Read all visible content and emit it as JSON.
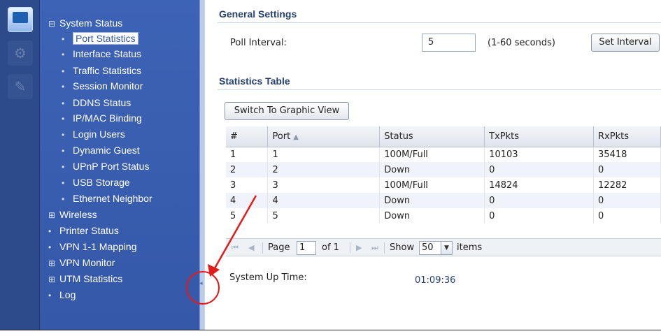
{
  "nav": {
    "items": [
      {
        "prefix": "⊟",
        "label": "System Status",
        "level": 0
      },
      {
        "prefix": "•",
        "label": "Port Statistics",
        "level": 1,
        "selected": true
      },
      {
        "prefix": "•",
        "label": "Interface Status",
        "level": 1
      },
      {
        "prefix": "•",
        "label": "Traffic Statistics",
        "level": 1
      },
      {
        "prefix": "•",
        "label": "Session Monitor",
        "level": 1
      },
      {
        "prefix": "•",
        "label": "DDNS Status",
        "level": 1
      },
      {
        "prefix": "•",
        "label": "IP/MAC Binding",
        "level": 1
      },
      {
        "prefix": "•",
        "label": "Login Users",
        "level": 1
      },
      {
        "prefix": "•",
        "label": "Dynamic Guest",
        "level": 1
      },
      {
        "prefix": "•",
        "label": "UPnP Port Status",
        "level": 1
      },
      {
        "prefix": "•",
        "label": "USB Storage",
        "level": 1
      },
      {
        "prefix": "•",
        "label": "Ethernet Neighbor",
        "level": 1
      },
      {
        "prefix": "⊞",
        "label": "Wireless",
        "level": 0
      },
      {
        "prefix": "•",
        "label": "Printer Status",
        "level": 0
      },
      {
        "prefix": "•",
        "label": "VPN 1-1 Mapping",
        "level": 0
      },
      {
        "prefix": "⊞",
        "label": "VPN Monitor",
        "level": 0
      },
      {
        "prefix": "⊞",
        "label": "UTM Statistics",
        "level": 0
      },
      {
        "prefix": "•",
        "label": "Log",
        "level": 0
      }
    ]
  },
  "general": {
    "title": "General Settings",
    "poll_label": "Poll Interval:",
    "poll_value": "5",
    "poll_hint": "(1-60 seconds)",
    "set_button": "Set Interval"
  },
  "stats": {
    "title": "Statistics Table",
    "graphic_button": "Switch To Graphic View",
    "columns": [
      "#",
      "Port",
      "Status",
      "TxPkts",
      "RxPkts"
    ],
    "sort_indicator": "▲",
    "rows": [
      [
        "1",
        "1",
        "100M/Full",
        "10103",
        "35418"
      ],
      [
        "2",
        "2",
        "Down",
        "0",
        "0"
      ],
      [
        "3",
        "3",
        "100M/Full",
        "14824",
        "12282"
      ],
      [
        "4",
        "4",
        "Down",
        "0",
        "0"
      ],
      [
        "5",
        "5",
        "Down",
        "0",
        "0"
      ]
    ]
  },
  "pager": {
    "first": "⏮",
    "prev": "◀",
    "page_label": "Page",
    "page_value": "1",
    "of_label": "of 1",
    "next": "▶",
    "last": "⏭",
    "show_label": "Show",
    "show_value": "50",
    "items_label": "items"
  },
  "uptime": {
    "label": "System Up Time:",
    "value": "01:09:36"
  },
  "colors": {
    "nav_bg": "#3558a8",
    "strip_bg": "#2d4a8a",
    "annotation": "#e21b1b",
    "heading": "#26406f"
  }
}
